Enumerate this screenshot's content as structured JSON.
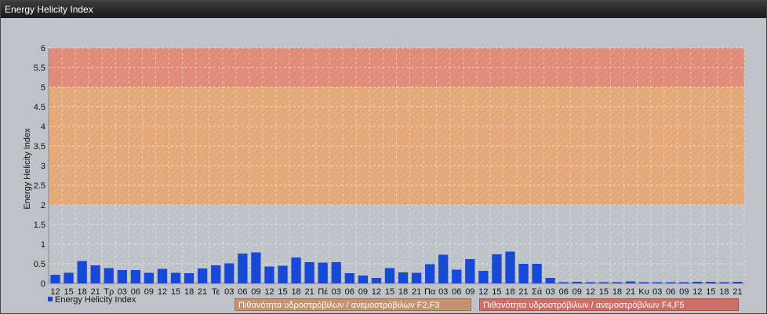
{
  "window": {
    "title": "Energy Helicity Index"
  },
  "colors": {
    "bar": "#1849d6",
    "zone_red": "#e08a78",
    "zone_orange": "#e2a877",
    "zone_orange_dark": "#d8a07a",
    "plot_bg": "#bdc2c6"
  },
  "legend": {
    "series_label": "Energy Helicity Index",
    "band1_label": "Πιθανότητα υδροστρόβιλων / ανεμοστρόβιλων F2,F3",
    "band2_label": "Πιθανότητα υδροστρόβιλων / ανεμοστρόβιλων F4,F5"
  },
  "chart_data": {
    "type": "bar",
    "ylabel": "Energy Helicity Index",
    "xlabel": "",
    "ylim": [
      0,
      6
    ],
    "yticks": [
      "0",
      "0.5",
      "1",
      "1.5",
      "2",
      "2.5",
      "3",
      "3.5",
      "4",
      "4.5",
      "5",
      "5.5",
      "6"
    ],
    "grid": true,
    "zones": [
      {
        "from": 2,
        "to": 5,
        "color": "orange"
      },
      {
        "from": 5,
        "to": 6,
        "color": "red"
      }
    ],
    "categories": [
      "12",
      "15",
      "18",
      "21",
      "Τρ",
      "03",
      "06",
      "09",
      "12",
      "15",
      "18",
      "21",
      "Τε",
      "03",
      "06",
      "09",
      "12",
      "15",
      "18",
      "21",
      "Πέ",
      "03",
      "06",
      "09",
      "12",
      "15",
      "18",
      "21",
      "Πα",
      "03",
      "06",
      "09",
      "12",
      "15",
      "18",
      "21",
      "Σά",
      "03",
      "06",
      "09",
      "12",
      "15",
      "18",
      "21",
      "Κυ",
      "03",
      "06",
      "09",
      "12",
      "15",
      "18",
      "21"
    ],
    "values": [
      0.22,
      0.27,
      0.57,
      0.46,
      0.39,
      0.34,
      0.34,
      0.27,
      0.37,
      0.27,
      0.26,
      0.38,
      0.46,
      0.51,
      0.76,
      0.79,
      0.43,
      0.45,
      0.66,
      0.54,
      0.53,
      0.54,
      0.26,
      0.2,
      0.14,
      0.39,
      0.28,
      0.27,
      0.49,
      0.73,
      0.35,
      0.62,
      0.32,
      0.74,
      0.81,
      0.5,
      0.5,
      0.14,
      0.03,
      0.04,
      0.03,
      0.03,
      0.03,
      0.05,
      0.03,
      0.03,
      0.03,
      0.03,
      0.04,
      0.04,
      0.03,
      0.04
    ]
  }
}
